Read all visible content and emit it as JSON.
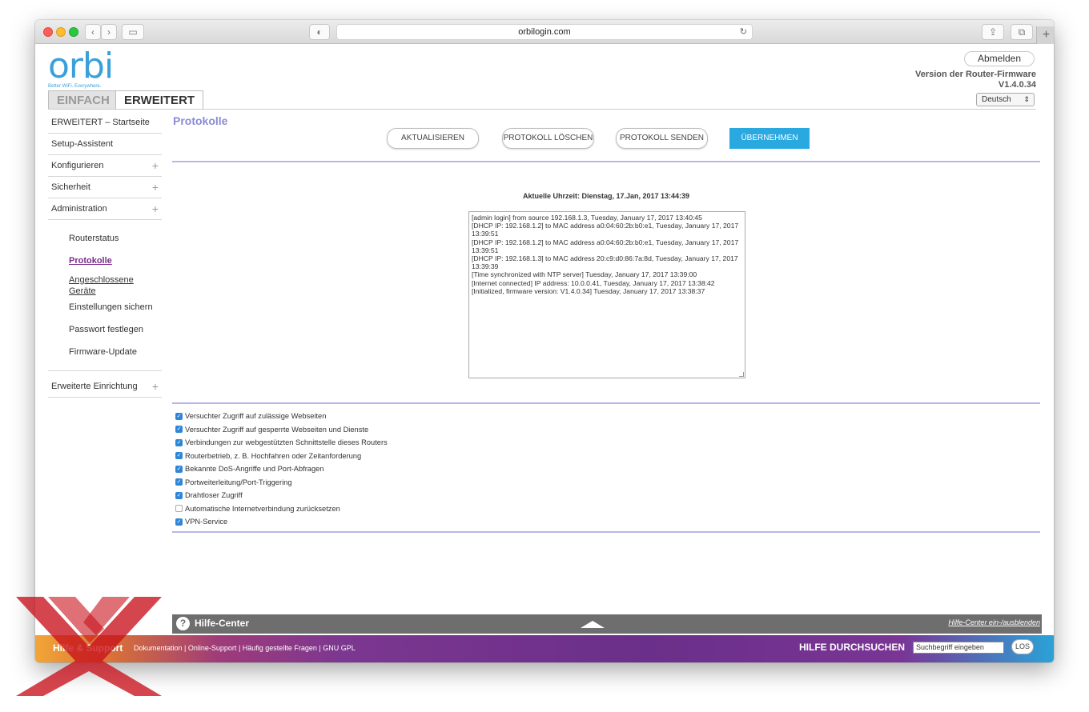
{
  "browser": {
    "url": "orbilogin.com"
  },
  "logo": {
    "text": "orbi",
    "tagline": "Better WiFi. Everywhere."
  },
  "mode_tabs": {
    "basic": "EINFACH",
    "advanced": "ERWEITERT"
  },
  "header": {
    "logout_label": "Abmelden",
    "firmware_label": "Version der Router-Firmware",
    "firmware_version": "V1.4.0.34",
    "language": "Deutsch"
  },
  "sidebar": {
    "items": [
      {
        "label": "ERWEITERT – Startseite"
      },
      {
        "label": "Setup-Assistent"
      },
      {
        "label": "Konfigurieren"
      },
      {
        "label": "Sicherheit"
      },
      {
        "label": "Administration"
      }
    ],
    "admin_sub": [
      {
        "label": "Routerstatus"
      },
      {
        "label": "Protokolle"
      },
      {
        "label": "Angeschlossene Geräte"
      },
      {
        "label": "Einstellungen sichern"
      },
      {
        "label": "Passwort festlegen"
      },
      {
        "label": "Firmware-Update"
      }
    ],
    "advanced_setup": "Erweiterte Einrichtung"
  },
  "main": {
    "title": "Protokolle",
    "buttons": {
      "refresh": "AKTUALISIEREN",
      "clear": "PROTOKOLL LÖSCHEN",
      "send": "PROTOKOLL SENDEN",
      "apply": "ÜBERNEHMEN"
    },
    "current_time": "Aktuelle Uhrzeit: Dienstag, 17.Jan, 2017 13:44:39",
    "log_lines": [
      "[admin login] from source 192.168.1.3, Tuesday, January 17, 2017 13:40:45",
      "[DHCP IP: 192.168.1.2] to MAC address a0:04:60:2b:b0:e1, Tuesday, January 17, 2017 13:39:51",
      "[DHCP IP: 192.168.1.2] to MAC address a0:04:60:2b:b0:e1, Tuesday, January 17, 2017 13:39:51",
      "[DHCP IP: 192.168.1.3] to MAC address 20:c9:d0:86:7a:8d, Tuesday, January 17, 2017 13:39:39",
      "[Time synchronized with NTP server] Tuesday, January 17, 2017 13:39:00",
      "[Internet connected] IP address: 10.0.0.41, Tuesday, January 17, 2017 13:38:42",
      "[Initialized, firmware version: V1.4.0.34] Tuesday, January 17, 2017 13:38:37"
    ],
    "checkboxes": [
      {
        "label": "Versuchter Zugriff auf zulässige Webseiten",
        "checked": true
      },
      {
        "label": "Versuchter Zugriff auf gesperrte Webseiten und Dienste",
        "checked": true
      },
      {
        "label": "Verbindungen zur webgestützten Schnittstelle dieses Routers",
        "checked": true
      },
      {
        "label": "Routerbetrieb, z. B. Hochfahren oder Zeitanforderung",
        "checked": true
      },
      {
        "label": "Bekannte DoS-Angriffe und Port-Abfragen",
        "checked": true
      },
      {
        "label": "Portweiterleitung/Port-Triggering",
        "checked": true
      },
      {
        "label": "Drahtloser Zugriff",
        "checked": true
      },
      {
        "label": "Automatische Internetverbindung zurücksetzen",
        "checked": false
      },
      {
        "label": "VPN-Service",
        "checked": true
      }
    ]
  },
  "help": {
    "title": "Hilfe-Center",
    "toggle": "Hilfe-Center ein-/ausblenden"
  },
  "footer": {
    "title": "Hilfe & Support",
    "links": [
      "Dokumentation",
      "Online-Support",
      "Häufig gestellte Fragen",
      "GNU GPL"
    ],
    "search_label": "HILFE DURCHSUCHEN",
    "search_placeholder": "Suchbegriff eingeben",
    "go_label": "LOS"
  },
  "colors": {
    "accent": "#2aa8e0",
    "active_nav": "#7a2b8c",
    "title": "#8a8ad6"
  }
}
